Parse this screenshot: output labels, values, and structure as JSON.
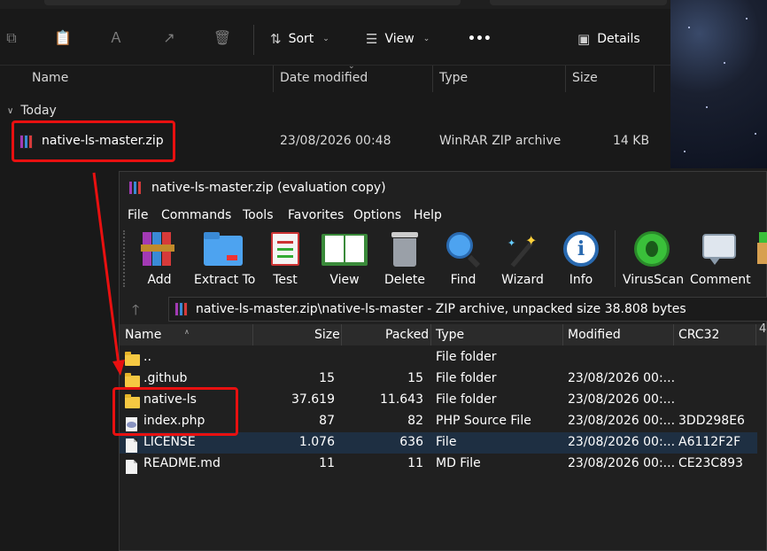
{
  "explorer": {
    "toolbar": {
      "sort_label": "Sort",
      "view_label": "View",
      "more_label": "•••",
      "details_label": "Details"
    },
    "columns": {
      "name": "Name",
      "date_modified": "Date modified",
      "type": "Type",
      "size": "Size"
    },
    "group_label": "Today",
    "file": {
      "name": "native-ls-master.zip",
      "date": "23/08/2026 00:48",
      "type": "WinRAR ZIP archive",
      "size": "14 KB"
    }
  },
  "winrar": {
    "title": "native-ls-master.zip (evaluation copy)",
    "menu": [
      "File",
      "Commands",
      "Tools",
      "Favorites",
      "Options",
      "Help"
    ],
    "tools": [
      "Add",
      "Extract To",
      "Test",
      "View",
      "Delete",
      "Find",
      "Wizard",
      "Info",
      "VirusScan",
      "Comment"
    ],
    "address": "native-ls-master.zip\\native-ls-master - ZIP archive, unpacked size 38.808 bytes",
    "columns": {
      "name": "Name",
      "size": "Size",
      "packed": "Packed",
      "type": "Type",
      "modified": "Modified",
      "crc": "CRC32",
      "extra": "4"
    },
    "rows": [
      {
        "name": "..",
        "size": "",
        "packed": "",
        "type": "File folder",
        "modified": "",
        "crc": ""
      },
      {
        "name": ".github",
        "size": "15",
        "packed": "15",
        "type": "File folder",
        "modified": "23/08/2026 00:...",
        "crc": ""
      },
      {
        "name": "native-ls",
        "size": "37.619",
        "packed": "11.643",
        "type": "File folder",
        "modified": "23/08/2026 00:...",
        "crc": ""
      },
      {
        "name": "index.php",
        "size": "87",
        "packed": "82",
        "type": "PHP Source File",
        "modified": "23/08/2026 00:...",
        "crc": "3DD298E6"
      },
      {
        "name": "LICENSE",
        "size": "1.076",
        "packed": "636",
        "type": "File",
        "modified": "23/08/2026 00:...",
        "crc": "A6112F2F"
      },
      {
        "name": "README.md",
        "size": "11",
        "packed": "11",
        "type": "MD File",
        "modified": "23/08/2026 00:...",
        "crc": "CE23C893"
      }
    ]
  },
  "colors": {
    "highlight_red": "#e81010",
    "selected_row": "#1e2f42",
    "explorer_bg": "#191919",
    "winrar_bg": "#202020"
  }
}
